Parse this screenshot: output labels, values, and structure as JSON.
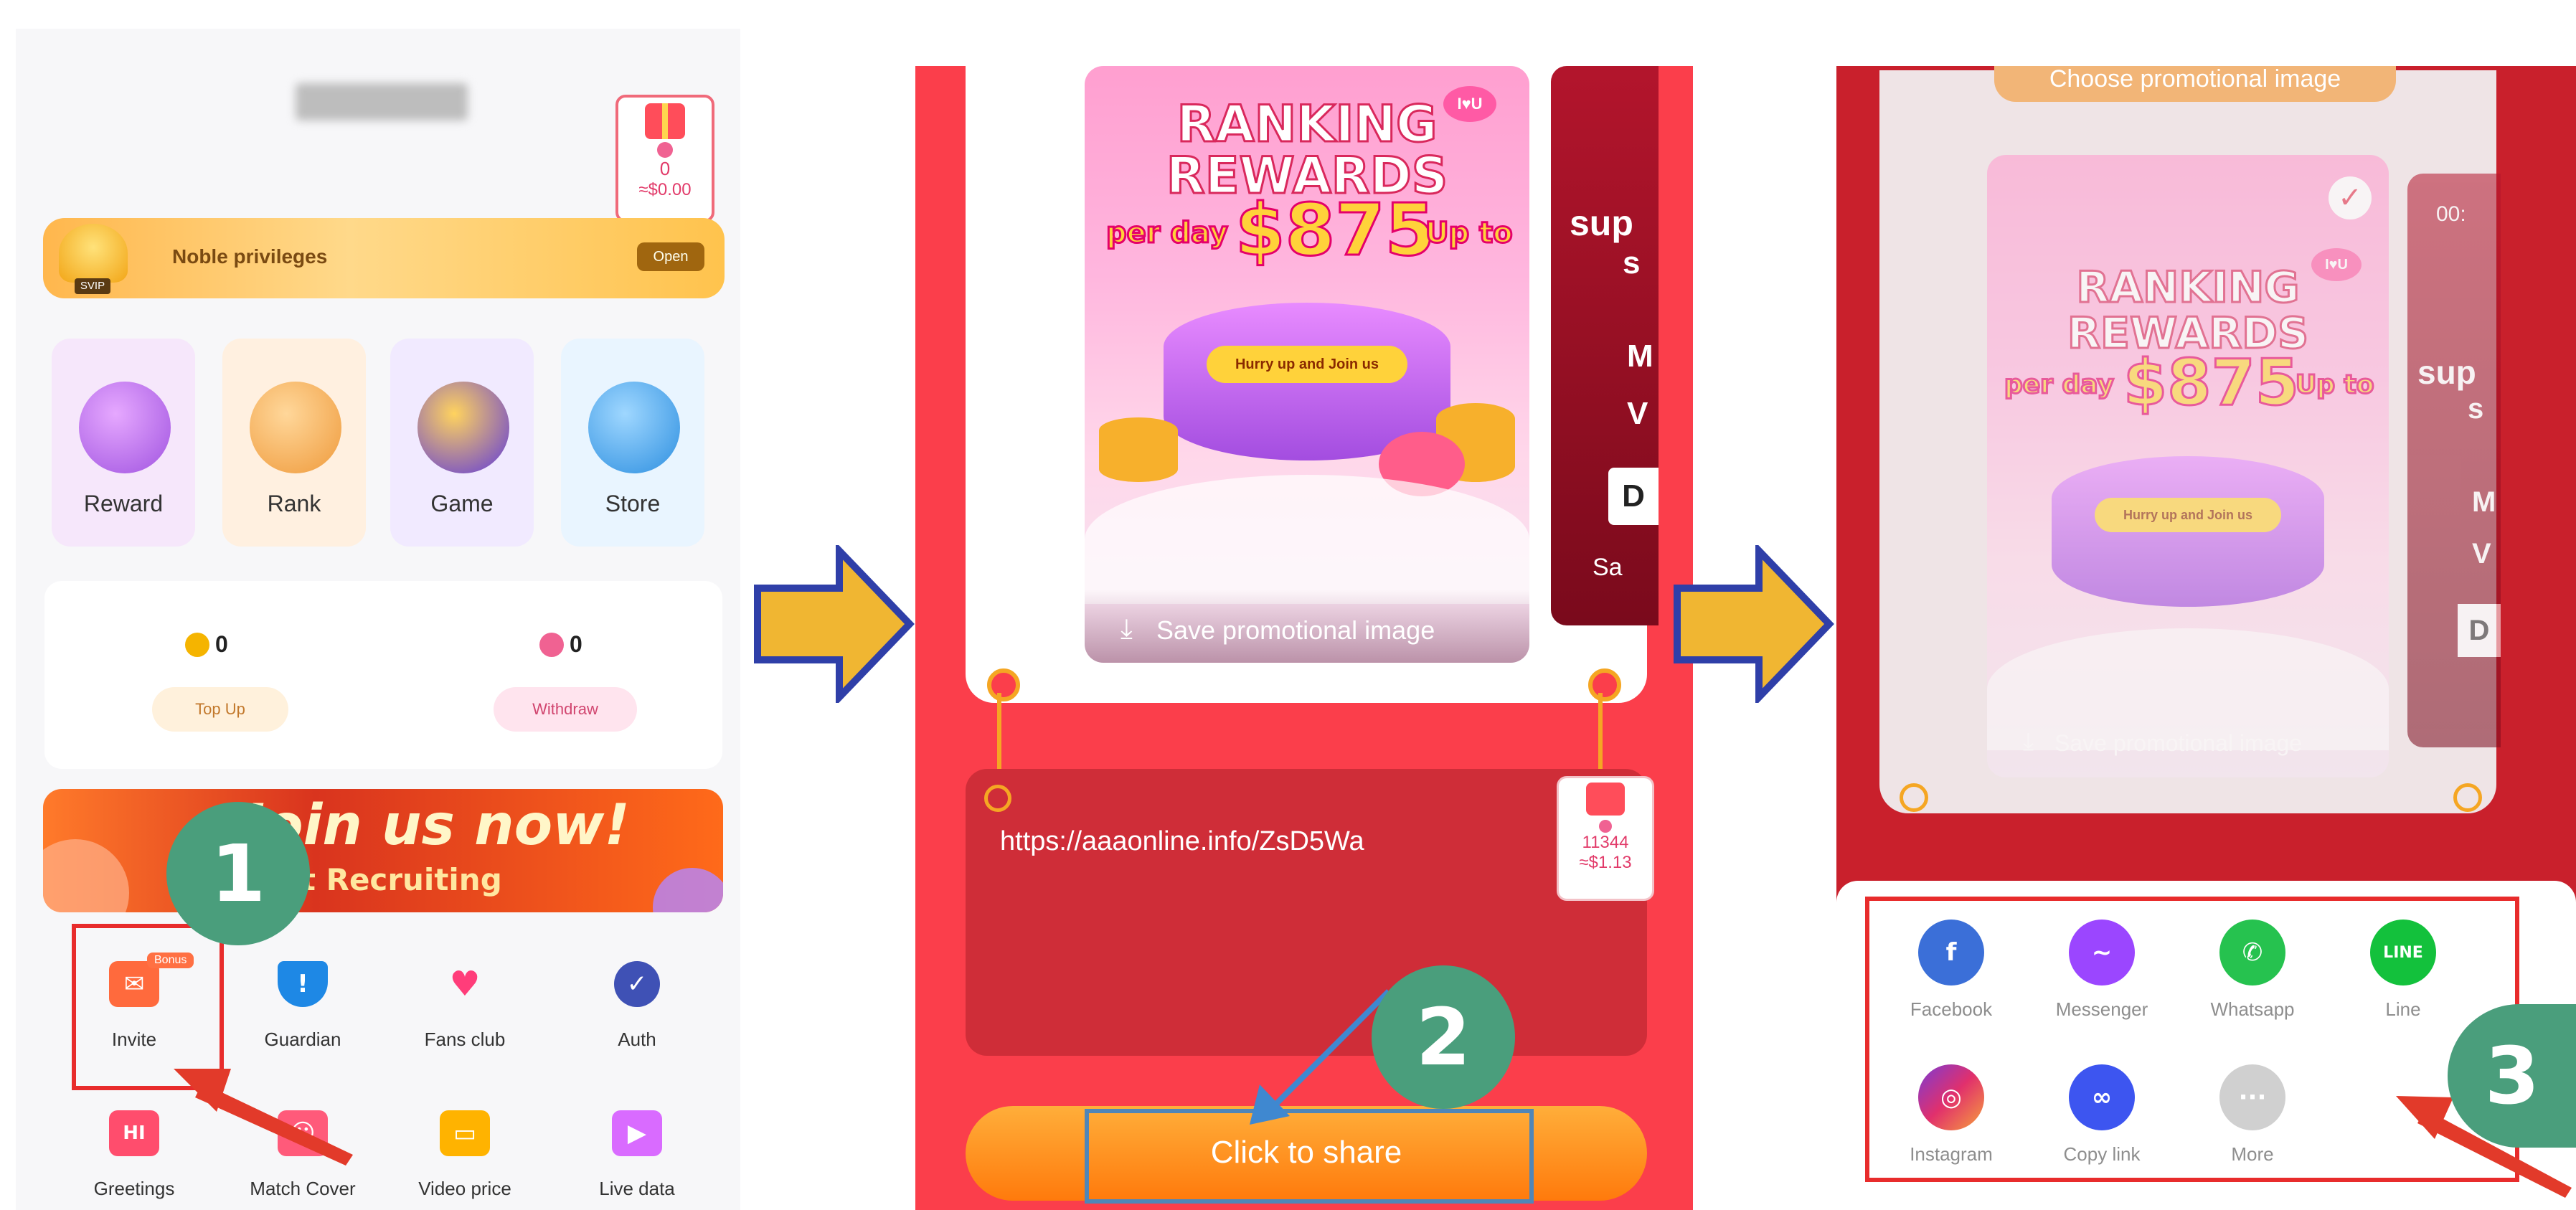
{
  "panel1": {
    "balance_box": {
      "count": "0",
      "amount": "≈$0.00"
    },
    "noble": {
      "badge": "SVIP",
      "label": "Noble privileges",
      "open": "Open"
    },
    "tiles": [
      "Reward",
      "Rank",
      "Game",
      "Store"
    ],
    "coins": {
      "value": "0",
      "button": "Top Up"
    },
    "diamonds": {
      "value": "0",
      "button": "Withdraw"
    },
    "banner": {
      "line1": "Join us now!",
      "line2": "nt Recruiting"
    },
    "services_row1": [
      {
        "label": "Invite",
        "tag": "Bonus",
        "icon": "invite-icon",
        "color": "#ff6a3d"
      },
      {
        "label": "Guardian",
        "icon": "shield-icon",
        "color": "#1e88e5"
      },
      {
        "label": "Fans club",
        "icon": "hearts-icon",
        "color": "#ff3d7a"
      },
      {
        "label": "Auth",
        "icon": "verified-icon",
        "color": "#3f51b5"
      }
    ],
    "services_row2": [
      {
        "label": "Greetings",
        "icon": "hi-icon",
        "glyph": "HI",
        "color": "#ff4d6d"
      },
      {
        "label": "Match Cover",
        "icon": "person-card-icon",
        "color": "#ff5a7a"
      },
      {
        "label": "Video price",
        "icon": "wallet-icon",
        "color": "#ffb300"
      },
      {
        "label": "Live data",
        "icon": "chart-icon",
        "color": "#d96bff"
      }
    ]
  },
  "panel2": {
    "promo": {
      "tag": "I♥U",
      "title1": "RANKING",
      "title2": "REWARDS",
      "per_day": "per day",
      "amount": "$875",
      "up_to": "Up to",
      "hurry": "Hurry up and Join us",
      "save": "Save promotional image"
    },
    "side_card": {
      "text1": "sup",
      "text2": "s",
      "text3": "M",
      "text4": "V",
      "text5": "D",
      "save": "Sa"
    },
    "link": "https://aaaonline.info/ZsD5Wa",
    "mini_box": {
      "count": "11344",
      "amount": "≈$1.13"
    },
    "share_button": "Click to share"
  },
  "panel3": {
    "choose_label": "Choose promotional image",
    "side_time": "00:",
    "share_row1": [
      {
        "label": "Facebook",
        "icon": "facebook-icon",
        "glyph": "f",
        "color": "#3b6fd8"
      },
      {
        "label": "Messenger",
        "icon": "messenger-icon",
        "glyph": "~",
        "color": "#9b46ff"
      },
      {
        "label": "Whatsapp",
        "icon": "whatsapp-icon",
        "glyph": "✆",
        "color": "#26c24f"
      },
      {
        "label": "Line",
        "icon": "line-icon",
        "glyph": "LINE",
        "color": "#13c13c"
      }
    ],
    "share_row2": [
      {
        "label": "Instagram",
        "icon": "instagram-icon",
        "glyph": "◎",
        "color": "#d6336c"
      },
      {
        "label": "Copy link",
        "icon": "link-icon",
        "glyph": "∞",
        "color": "#3d55f0"
      },
      {
        "label": "More",
        "icon": "more-icon",
        "glyph": "···",
        "color": "#d0d0d0"
      }
    ]
  },
  "steps": [
    "1",
    "2",
    "3"
  ]
}
